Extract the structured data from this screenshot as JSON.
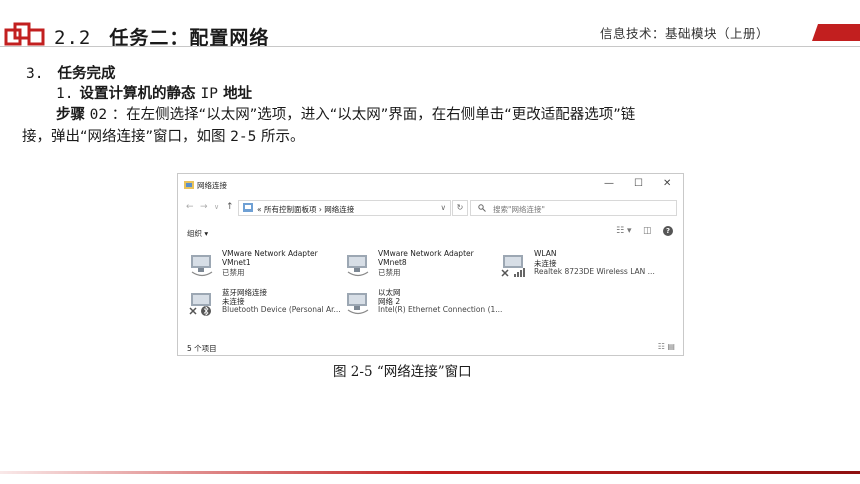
{
  "header": {
    "section_number": "2.2",
    "section_title": "任务二：配置网络",
    "book_title": "信息技术：基础模块（上册）",
    "accent_color": "#c21f1f"
  },
  "content": {
    "item_number": "3.",
    "item_title": "任务完成",
    "sub_number": "1.",
    "sub_title_a": "设置计算机的静态",
    "sub_title_ip": "IP",
    "sub_title_b": "地址",
    "step_label": "步骤",
    "step_number": "02",
    "para_line1": "：在左侧选择“以太网”选项，进入“以太网”界面，在右侧单击“更改适配器选项”链",
    "para_line2_a": "接，弹出“网络连接”窗口，如图",
    "para_line2_fig": "2-5",
    "para_line2_b": "所示。",
    "caption": "图 2-5  “网络连接”窗口"
  },
  "window": {
    "title": "网络连接",
    "controls": {
      "minimize": "—",
      "maximize": "☐",
      "close": "✕"
    },
    "nav": {
      "back": "←",
      "forward": "→",
      "dropdown": "∨",
      "up": "↑"
    },
    "address": "« 所有控制面板项 › 网络连接",
    "address_dropdown": "∨",
    "refresh": "↻",
    "search_placeholder": "搜索\"网络连接\"",
    "organize": "组织 ▾",
    "toolbar_icons": {
      "view": "☷ ▾",
      "pane": "◫",
      "help": "?"
    },
    "adapters": [
      {
        "name": "VMware Network Adapter",
        "device": "VMnet1",
        "status": "已禁用"
      },
      {
        "name": "VMware Network Adapter",
        "device": "VMnet8",
        "status": "已禁用"
      },
      {
        "name": "WLAN",
        "device": "未连接",
        "status": "Realtek 8723DE Wireless LAN ..."
      },
      {
        "name": "蓝牙网络连接",
        "device": "未连接",
        "status": "Bluetooth Device (Personal Ar..."
      },
      {
        "name": "以太网",
        "device": "网络 2",
        "status": "Intel(R) Ethernet Connection (1..."
      }
    ],
    "status_bar": "5 个项目",
    "status_icons": "☷ ▤"
  }
}
